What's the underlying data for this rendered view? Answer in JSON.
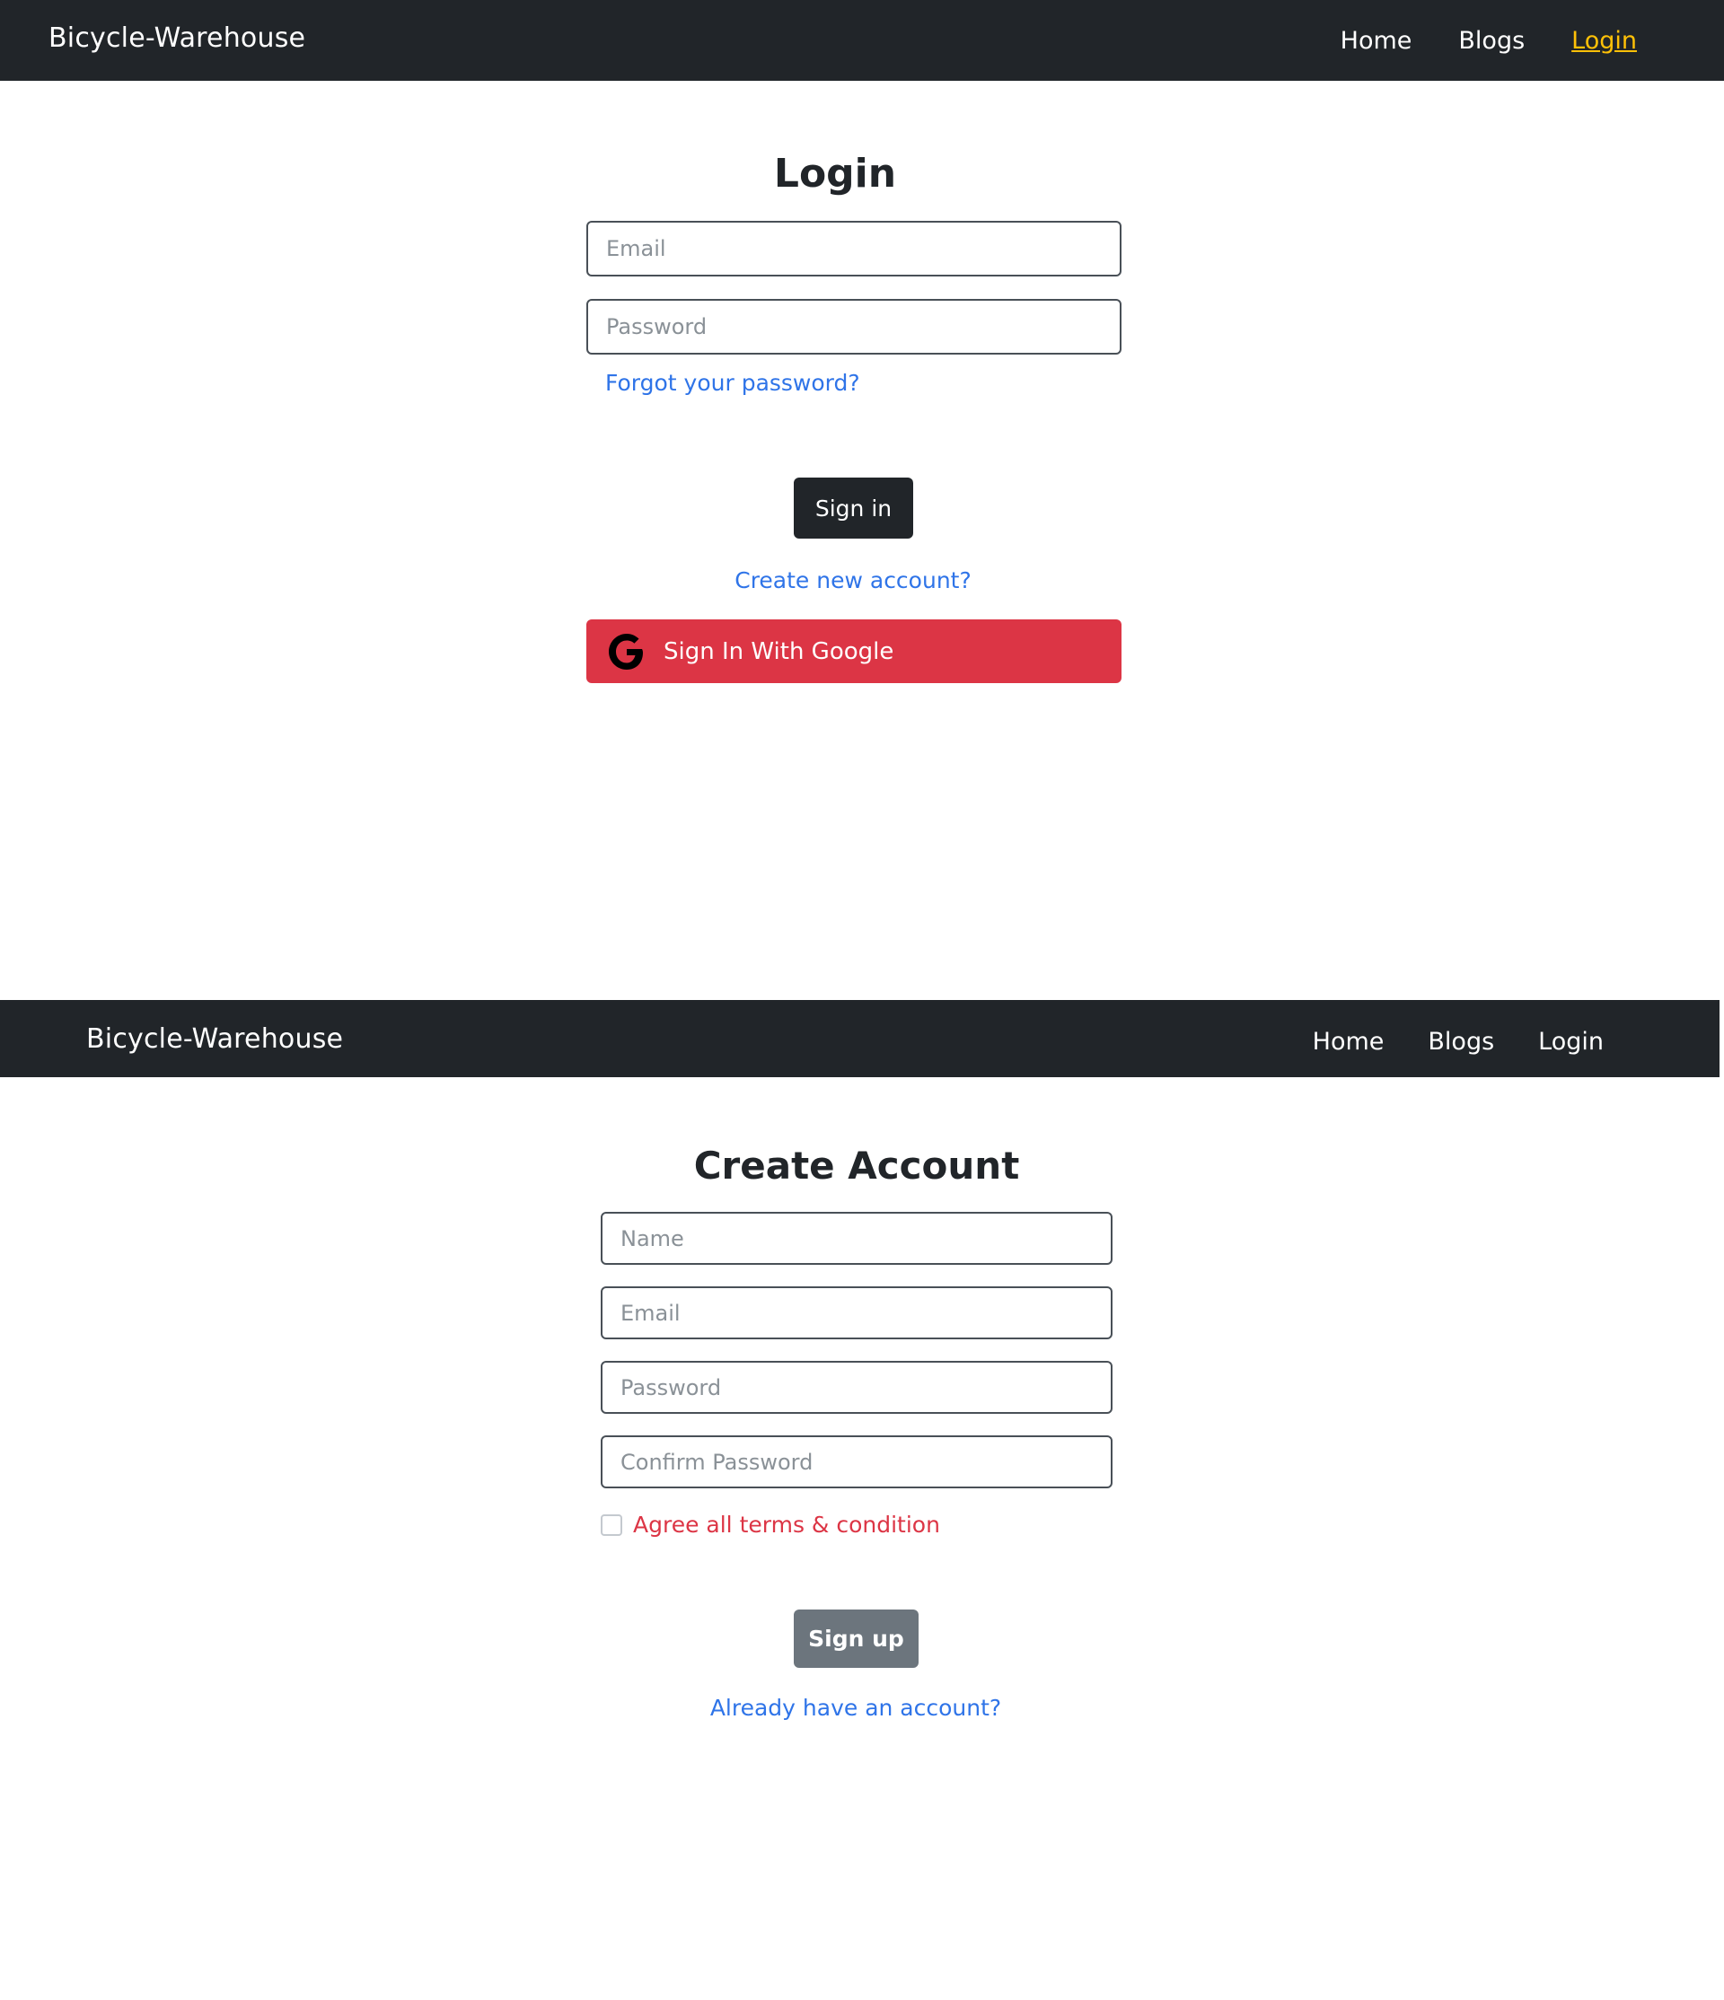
{
  "login_screen": {
    "navbar": {
      "brand": "Bicycle-Warehouse",
      "links": [
        "Home",
        "Blogs",
        "Login"
      ],
      "active_link": "Login",
      "active_color": "#ffc107"
    },
    "title": "Login",
    "email_placeholder": "Email",
    "password_placeholder": "Password",
    "forgot_password_link": "Forgot your password?",
    "sign_in_button": "Sign in",
    "create_account_link": "Create new account?",
    "google_button": {
      "label": "Sign In With Google",
      "icon": "google-icon",
      "color": "#dc3545"
    }
  },
  "signup_screen": {
    "navbar": {
      "brand": "Bicycle-Warehouse",
      "links": [
        "Home",
        "Blogs",
        "Login"
      ]
    },
    "title": "Create Account",
    "name_placeholder": "Name",
    "email_placeholder": "Email",
    "password_placeholder": "Password",
    "confirm_password_placeholder": "Confirm Password",
    "terms_label": "Agree all terms & condition",
    "terms_checked": false,
    "sign_up_button": "Sign up",
    "sign_up_disabled": true,
    "already_have_account_link": "Already have an account?"
  },
  "colors": {
    "navbar_bg": "#212529",
    "link": "#2f74e8",
    "dark_button": "#212529",
    "disabled_button": "#6c757d",
    "danger": "#dc3545"
  }
}
